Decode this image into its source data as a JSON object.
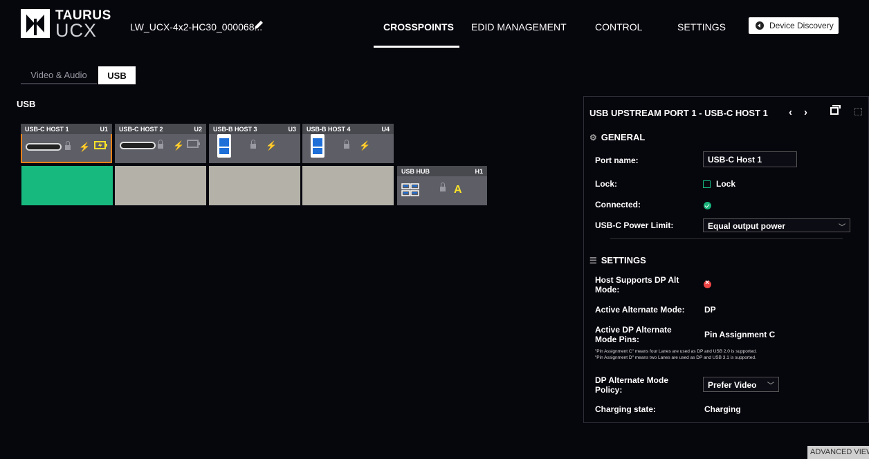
{
  "brand": {
    "line1": "TAURUS",
    "line2": "UCX"
  },
  "device": {
    "name": "LW_UCX-4x2-HC30_000068...",
    "edit_icon": "pencil-icon"
  },
  "nav": {
    "items": [
      "CROSSPOINTS",
      "EDID MANAGEMENT",
      "CONTROL",
      "SETTINGS"
    ],
    "active": "CROSSPOINTS",
    "discovery_label": "Device Discovery"
  },
  "tabs": {
    "video_audio": "Video & Audio",
    "usb": "USB",
    "active": "USB"
  },
  "section_title": "USB",
  "ports": [
    {
      "name": "USB-C HOST 1",
      "id": "U1",
      "type": "usb-c",
      "selected": true
    },
    {
      "name": "USB-C HOST 2",
      "id": "U2",
      "type": "usb-c",
      "selected": false
    },
    {
      "name": "USB-B HOST 3",
      "id": "U3",
      "type": "usb-b",
      "selected": false
    },
    {
      "name": "USB-B HOST 4",
      "id": "U4",
      "type": "usb-b",
      "selected": false
    }
  ],
  "hub": {
    "name": "USB HUB",
    "id": "H1",
    "mode": "A"
  },
  "crosspoint": {
    "connected_port": "U1"
  },
  "panel": {
    "title": "USB UPSTREAM PORT 1 - USB-C HOST 1",
    "general_title": "GENERAL",
    "port_name_label": "Port name:",
    "port_name_value": "USB-C Host 1",
    "lock_label": "Lock:",
    "lock_checkbox_label": "Lock",
    "lock_checked": false,
    "connected_label": "Connected:",
    "connected": true,
    "power_limit_label": "USB-C Power Limit:",
    "power_limit_value": "Equal output power",
    "settings_title": "SETTINGS",
    "dp_alt_support_label_1": "Host Supports DP Alt",
    "dp_alt_support_label_2": "Mode:",
    "dp_alt_supported": false,
    "alt_mode_label": "Active Alternate Mode:",
    "alt_mode_value": "DP",
    "pins_label_1": "Active DP Alternate",
    "pins_label_2": "Mode Pins:",
    "pins_value": "Pin Assignment C",
    "note_1": "\"Pin Assignment C\" means four Lanes are used as DP and USB 2.0 is supported.",
    "note_2": "\"Pin Assignment D\" means two Lanes are used as DP and USB 3.1 is supported.",
    "policy_label_1": "DP Alternate Mode",
    "policy_label_2": "Policy:",
    "policy_value": "Prefer Video",
    "charging_label": "Charging state:",
    "charging_value": "Charging"
  },
  "advanced_view_label": "ADVANCED VIEW",
  "colors": {
    "accent_green": "#17b97f",
    "selection_orange": "#e8821a",
    "power_yellow": "#f7e12a",
    "usb_blue": "#1e6fd8"
  }
}
